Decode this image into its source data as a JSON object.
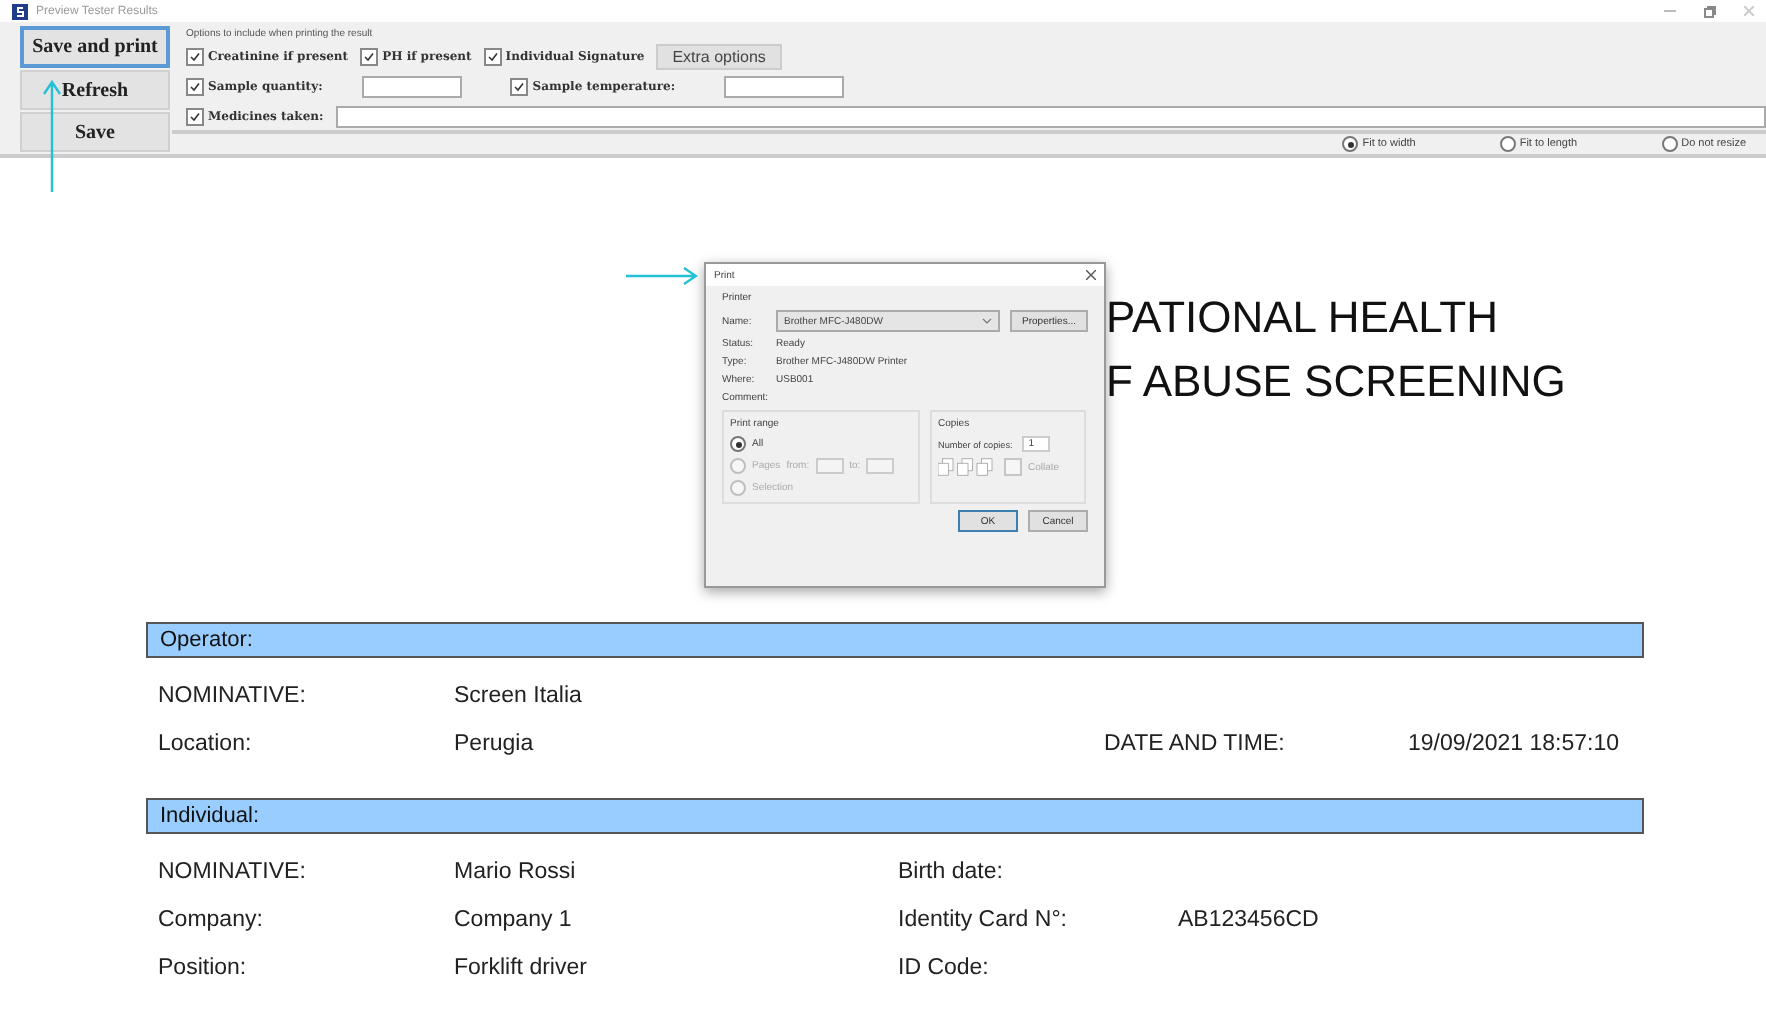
{
  "window": {
    "title": "Preview Tester Results"
  },
  "toolbar": {
    "buttons": [
      {
        "label": "Save and print",
        "selected": true
      },
      {
        "label": "Refresh",
        "selected": false
      },
      {
        "label": "Save",
        "selected": false
      }
    ]
  },
  "options": {
    "caption": "Options to include when printing the result",
    "rows": [
      {
        "items": [
          {
            "kind": "checkbox",
            "label": "Creatinine if present",
            "checked": true
          },
          {
            "kind": "checkbox",
            "label": "PH if present",
            "checked": true
          },
          {
            "kind": "checkbox",
            "label": "Individual Signature",
            "checked": true
          },
          {
            "kind": "button",
            "label": "Extra options"
          }
        ]
      },
      {
        "items": [
          {
            "kind": "field",
            "label": "Sample quantity:",
            "checked": true
          },
          {
            "kind": "field",
            "label": "Sample temperature:",
            "checked": true
          }
        ]
      },
      {
        "items": [
          {
            "kind": "wide_field",
            "label": "Medicines taken:",
            "checked": true
          }
        ]
      }
    ]
  },
  "resize_options": [
    {
      "label": "Fit to width",
      "selected": true
    },
    {
      "label": "Fit to length",
      "selected": false
    },
    {
      "label": "Do not resize",
      "selected": false
    }
  ],
  "report": {
    "heading_lines": [
      "PATIONAL HEALTH",
      "F ABUSE SCREENING"
    ],
    "sections": [
      {
        "title": "Operator:",
        "kind": "operator",
        "rows": [
          [
            "NOMINATIVE:",
            "Screen Italia"
          ],
          [
            "Location:",
            "Perugia",
            "DATE AND TIME:",
            "19/09/2021 18:57:10"
          ]
        ]
      },
      {
        "title": "Individual:",
        "kind": "individual",
        "rows": [
          [
            "NOMINATIVE:",
            "Mario Rossi",
            "Birth date:"
          ],
          [
            "Company:",
            "Company 1",
            "Identity Card N°:",
            "AB123456CD"
          ],
          [
            "Position:",
            "Forklift driver",
            "ID Code:"
          ]
        ]
      }
    ]
  },
  "print_dialog": {
    "title": "Print",
    "printer_group": "Printer",
    "name_label": "Name:",
    "printer_name": "Brother MFC-J480DW",
    "properties_button": "Properties...",
    "info": [
      {
        "label": "Status:",
        "value": "Ready"
      },
      {
        "label": "Type:",
        "value": "Brother MFC-J480DW Printer"
      },
      {
        "label": "Where:",
        "value": "USB001"
      },
      {
        "label": "Comment:"
      }
    ],
    "range_group": "Print range",
    "range_options": [
      {
        "label": "All",
        "selected": true,
        "disabled": false
      },
      {
        "label": "Pages",
        "selected": false,
        "disabled": true
      },
      {
        "label": "Selection",
        "selected": false,
        "disabled": true
      }
    ],
    "from_label": "from:",
    "to_label": "to:",
    "copies_group": "Copies",
    "copies_label": "Number of copies:",
    "copies": "1",
    "collate": {
      "label": "Collate",
      "checked": false,
      "disabled": true
    },
    "ok": "OK",
    "cancel": "Cancel"
  }
}
